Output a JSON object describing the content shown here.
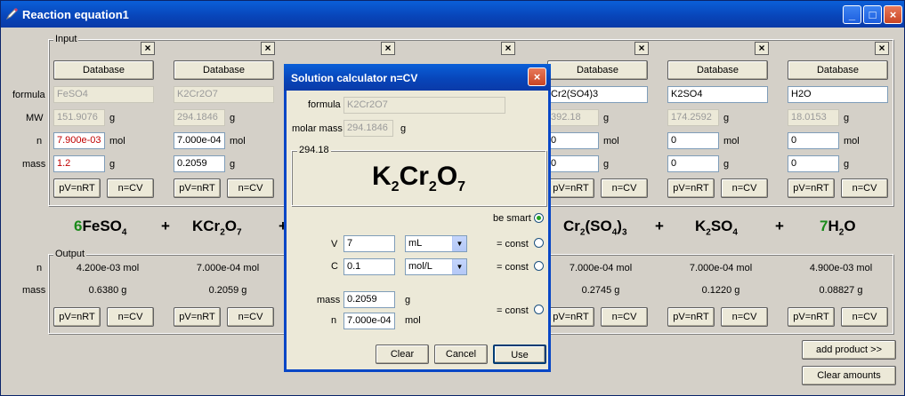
{
  "window": {
    "title": "Reaction equation1"
  },
  "input_group_label": "Input",
  "output_group_label": "Output",
  "row_labels": {
    "formula": "formula",
    "mw": "MW",
    "n": "n",
    "mass": "mass"
  },
  "units": {
    "g": "g",
    "mol": "mol"
  },
  "buttons": {
    "database": "Database",
    "pv": "pV=nRT",
    "ncv": "n=CV",
    "close": "×",
    "add_product": "add product >>",
    "clear_amounts": "Clear amounts"
  },
  "columns": [
    {
      "formula": "FeSO4",
      "mw": "151.9076",
      "n": "7.900e-03",
      "mass": "1.2",
      "formula_disabled": true,
      "n_red": true,
      "eq_coef": "6",
      "eq_formula": [
        [
          "Fe",
          ""
        ],
        [
          "SO",
          "4"
        ]
      ],
      "out_n": "4.200e-03 mol",
      "out_mass": "0.6380 g"
    },
    {
      "formula": "K2Cr2O7",
      "mw": "294.1846",
      "n": "7.000e-04",
      "mass": "0.2059",
      "formula_disabled": true,
      "n_red": false,
      "eq_coef": "",
      "eq_formula": [
        [
          "K",
          ""
        ],
        [
          "Cr",
          "2"
        ],
        [
          "O",
          "7"
        ]
      ],
      "out_n": "7.000e-04 mol",
      "out_mass": "0.2059 g"
    },
    {
      "formula": "",
      "mw": "",
      "n": "",
      "mass": "",
      "formula_disabled": true,
      "n_red": false,
      "eq_coef": "",
      "eq_formula": [],
      "out_n": "",
      "out_mass": ""
    },
    {
      "formula": "",
      "mw": "",
      "n": "",
      "mass": "",
      "formula_disabled": true,
      "n_red": false,
      "eq_coef": "",
      "eq_formula": [],
      "out_n": "",
      "out_mass": ""
    },
    {
      "formula": "Cr2(SO4)3",
      "mw": "392.18",
      "n": "0",
      "mass": "0",
      "formula_disabled": false,
      "n_red": false,
      "eq_coef": "",
      "eq_formula": [
        [
          "Cr",
          "2"
        ],
        [
          "(SO",
          "4"
        ],
        [
          ")",
          "3"
        ]
      ],
      "out_n": "7.000e-04 mol",
      "out_mass": "0.2745 g"
    },
    {
      "formula": "K2SO4",
      "mw": "174.2592",
      "n": "0",
      "mass": "0",
      "formula_disabled": false,
      "n_red": false,
      "eq_coef": "",
      "eq_formula": [
        [
          "K",
          "2"
        ],
        [
          "SO",
          "4"
        ]
      ],
      "out_n": "7.000e-04 mol",
      "out_mass": "0.1220 g"
    },
    {
      "formula": "H2O",
      "mw": "18.0153",
      "n": "0",
      "mass": "0",
      "formula_disabled": false,
      "n_red": false,
      "eq_coef": "7",
      "eq_formula": [
        [
          "H",
          "2"
        ],
        [
          "O",
          ""
        ]
      ],
      "out_n": "4.900e-03 mol",
      "out_mass": "0.08827 g"
    }
  ],
  "dialog": {
    "title": "Solution calculator n=CV",
    "formula_label": "formula",
    "formula_value": "K2Cr2O7",
    "molar_mass_label": "molar mass",
    "molar_mass_value": "294.1846",
    "molar_mass_unit": "g",
    "box_label": "294.18",
    "big_formula": [
      [
        "K",
        "2"
      ],
      [
        "Cr",
        "2"
      ],
      [
        "O",
        "7"
      ]
    ],
    "be_smart": "be smart",
    "v_label": "V",
    "v_value": "7",
    "v_unit": "mL",
    "c_label": "C",
    "c_value": "0.1",
    "c_unit": "mol/L",
    "const": "= const",
    "mass_label": "mass",
    "mass_value": "0.2059",
    "mass_unit": "g",
    "n_label": "n",
    "n_value": "7.000e-04",
    "n_unit": "mol",
    "clear": "Clear",
    "cancel": "Cancel",
    "use": "Use"
  }
}
